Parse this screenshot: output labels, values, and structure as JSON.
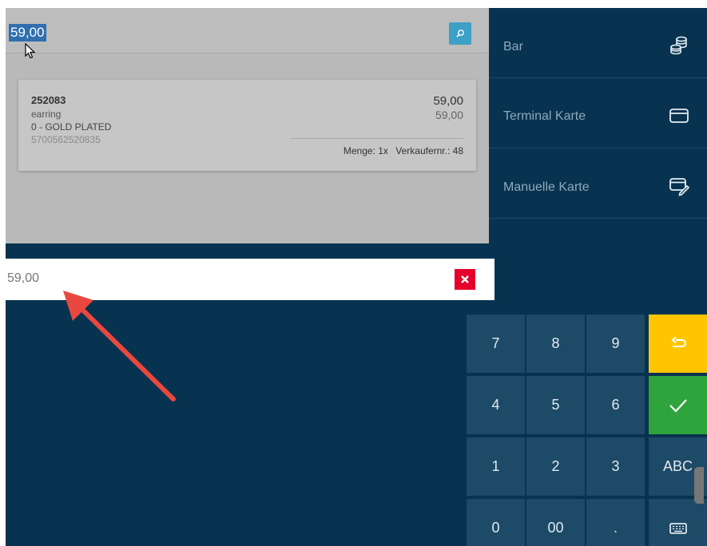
{
  "search": {
    "value": "59,00"
  },
  "item": {
    "sku": "252083",
    "description": "earring",
    "variant": "0 - GOLD PLATED",
    "ean": "5700562520835",
    "price": "59,00",
    "subtotal": "59,00",
    "quantity": "Menge: 1x",
    "seller": "Verkaufernr.: 48"
  },
  "payment_methods": [
    {
      "label": "Bar",
      "icon": "coins-icon"
    },
    {
      "label": "Terminal Karte",
      "icon": "card-terminal-icon"
    },
    {
      "label": "Manuelle Karte",
      "icon": "manual-card-icon"
    }
  ],
  "amount": {
    "value": "59,00"
  },
  "keypad": {
    "k7": "7",
    "k8": "8",
    "k9": "9",
    "k4": "4",
    "k5": "5",
    "k6": "6",
    "k1": "1",
    "k2": "2",
    "k3": "3",
    "abc": "ABC",
    "k0": "0",
    "k00": "00",
    "dot": "."
  },
  "colors": {
    "background": "#073350",
    "key": "#1d4a66",
    "back_key": "#ffc600",
    "confirm_key": "#2fa43d",
    "clear": "#e4002b",
    "annotation_arrow": "#e9483f"
  }
}
